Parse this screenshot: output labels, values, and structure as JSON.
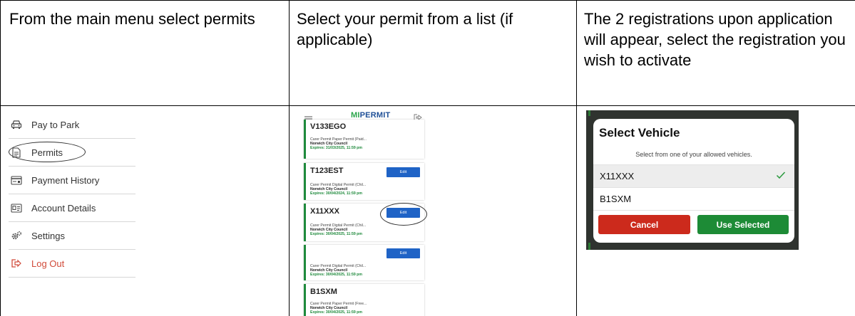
{
  "header_cells": {
    "col1": "From the main menu select permits",
    "col2": "Select your permit from a list (if applicable)",
    "col3": "The 2 registrations upon application will appear, select the registration you wish to activate"
  },
  "menu": {
    "items": [
      {
        "label": "Pay to Park",
        "icon": "car-icon"
      },
      {
        "label": "Permits",
        "icon": "document-icon"
      },
      {
        "label": "Payment History",
        "icon": "receipt-icon"
      },
      {
        "label": "Account Details",
        "icon": "id-card-icon"
      },
      {
        "label": "Settings",
        "icon": "gear-icon"
      },
      {
        "label": "Log Out",
        "icon": "logout-icon",
        "color": "#d14b3a"
      }
    ]
  },
  "phone": {
    "brand_mi": "MI",
    "brand_permit": "PERMIT",
    "edit_label": "Edit",
    "permits": [
      {
        "reg": "V133EGO",
        "type": "Carer Permit Paper Permit (Paid...",
        "council": "Norwich City Council",
        "expires": "Expires: 31/03/2025, 11:59 pm"
      },
      {
        "reg": "T123EST",
        "type": "Carer Permit Digital Permit (Chil...",
        "council": "Norwich City Council",
        "expires": "Expires: 30/04/2024, 11:59 pm"
      },
      {
        "reg": "X11XXX",
        "type": "Carer Permit Digital Permit (Chil...",
        "council": "Norwich City Council",
        "expires": "Expires: 30/04/2025, 11:59 pm"
      },
      {
        "reg": "",
        "type": "Carer Permit Digital Permit (Chil...",
        "council": "Norwich City Council",
        "expires": "Expires: 30/04/2025, 11:59 pm"
      },
      {
        "reg": "B1SXM",
        "type": "Carer Permit Paper Permit (Free...",
        "council": "Norwich City Council",
        "expires": "Expires: 30/04/2025, 11:59 pm"
      }
    ]
  },
  "modal": {
    "title": "Select Vehicle",
    "subtitle": "Select from one of your allowed vehicles.",
    "vehicles": [
      {
        "reg": "X11XXX",
        "selected": true
      },
      {
        "reg": "B1SXM",
        "selected": false
      }
    ],
    "cancel_label": "Cancel",
    "use_label": "Use Selected"
  },
  "colors": {
    "brand_green": "#2aa54a",
    "brand_blue": "#1e4f96",
    "edit_blue": "#1f63c6",
    "cancel_red": "#cc2a1c",
    "use_green": "#1d8b36"
  }
}
